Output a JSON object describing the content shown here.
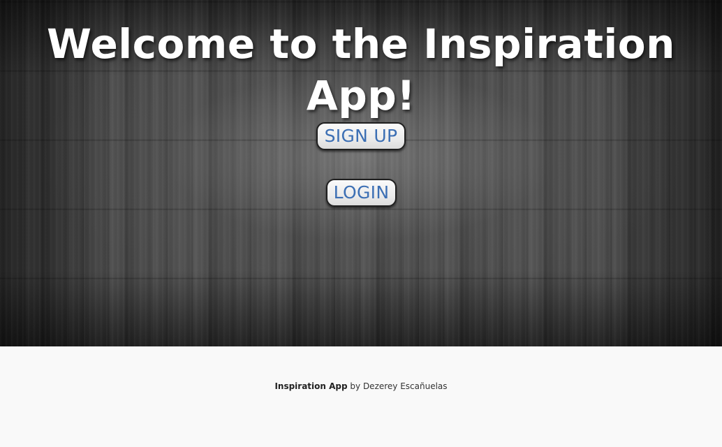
{
  "hero": {
    "title": "Welcome to the Inspiration App!"
  },
  "actions": {
    "signup_label": "SIGN UP",
    "login_label": "LOGIN"
  },
  "footer": {
    "app_name": "Inspiration App",
    "byline": " by Dezerey Escañuelas"
  },
  "colors": {
    "button_text": "#3c6fb4",
    "footer_background": "#f9f9f9",
    "title_text": "#ffffff"
  }
}
